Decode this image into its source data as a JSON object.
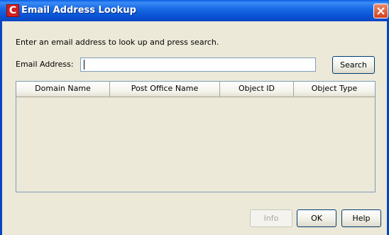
{
  "window": {
    "title": "Email Address Lookup",
    "app_icon_letter": "C",
    "close_icon": "close-icon"
  },
  "form": {
    "instruction": "Enter an email address to look up and press search.",
    "email_label": "Email Address:",
    "email_value": "",
    "email_placeholder": "",
    "search_label": "Search"
  },
  "table": {
    "columns": [
      "Domain Name",
      "Post Office Name",
      "Object ID",
      "Object Type"
    ],
    "rows": []
  },
  "buttons": {
    "info_label": "Info",
    "ok_label": "OK",
    "help_label": "Help"
  },
  "colors": {
    "titlebar": "#0a56d8",
    "dialog_bg": "#ece9d8",
    "close_button": "#d2401f"
  }
}
